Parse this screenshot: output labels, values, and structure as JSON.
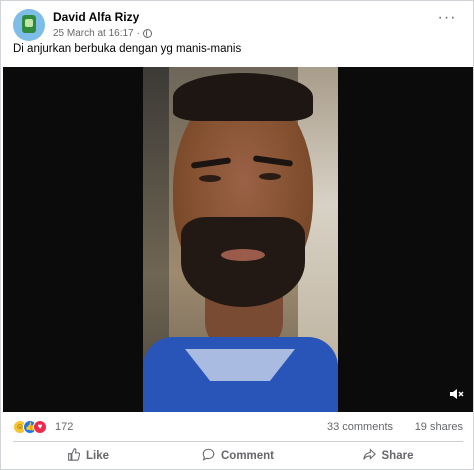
{
  "post": {
    "author": "David Alfa Rizy",
    "timestamp": "25 March at 16:17",
    "separator": "·",
    "caption": "Di anjurkan berbuka dengan yg manis-manis",
    "more_label": "···"
  },
  "video": {
    "mute_icon": "speaker-muted-icon"
  },
  "stats": {
    "reaction_count": "172",
    "comments": "33 comments",
    "shares": "19 shares",
    "reactions": [
      "haha",
      "like",
      "love"
    ]
  },
  "actions": {
    "like": "Like",
    "comment": "Comment",
    "share": "Share"
  },
  "colors": {
    "link_blue": "#1877f2",
    "love_red": "#f02849",
    "haha_yellow": "#f7c431",
    "secondary_text": "#65676b"
  }
}
